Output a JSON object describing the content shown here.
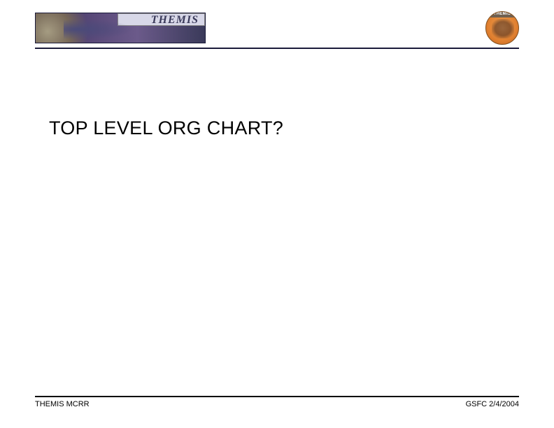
{
  "header": {
    "logo_text": "THEMIS",
    "badge_label": "THEMIS"
  },
  "content": {
    "title": "TOP LEVEL ORG CHART?"
  },
  "footer": {
    "left": "THEMIS MCRR",
    "right": "GSFC 2/4/2004"
  }
}
